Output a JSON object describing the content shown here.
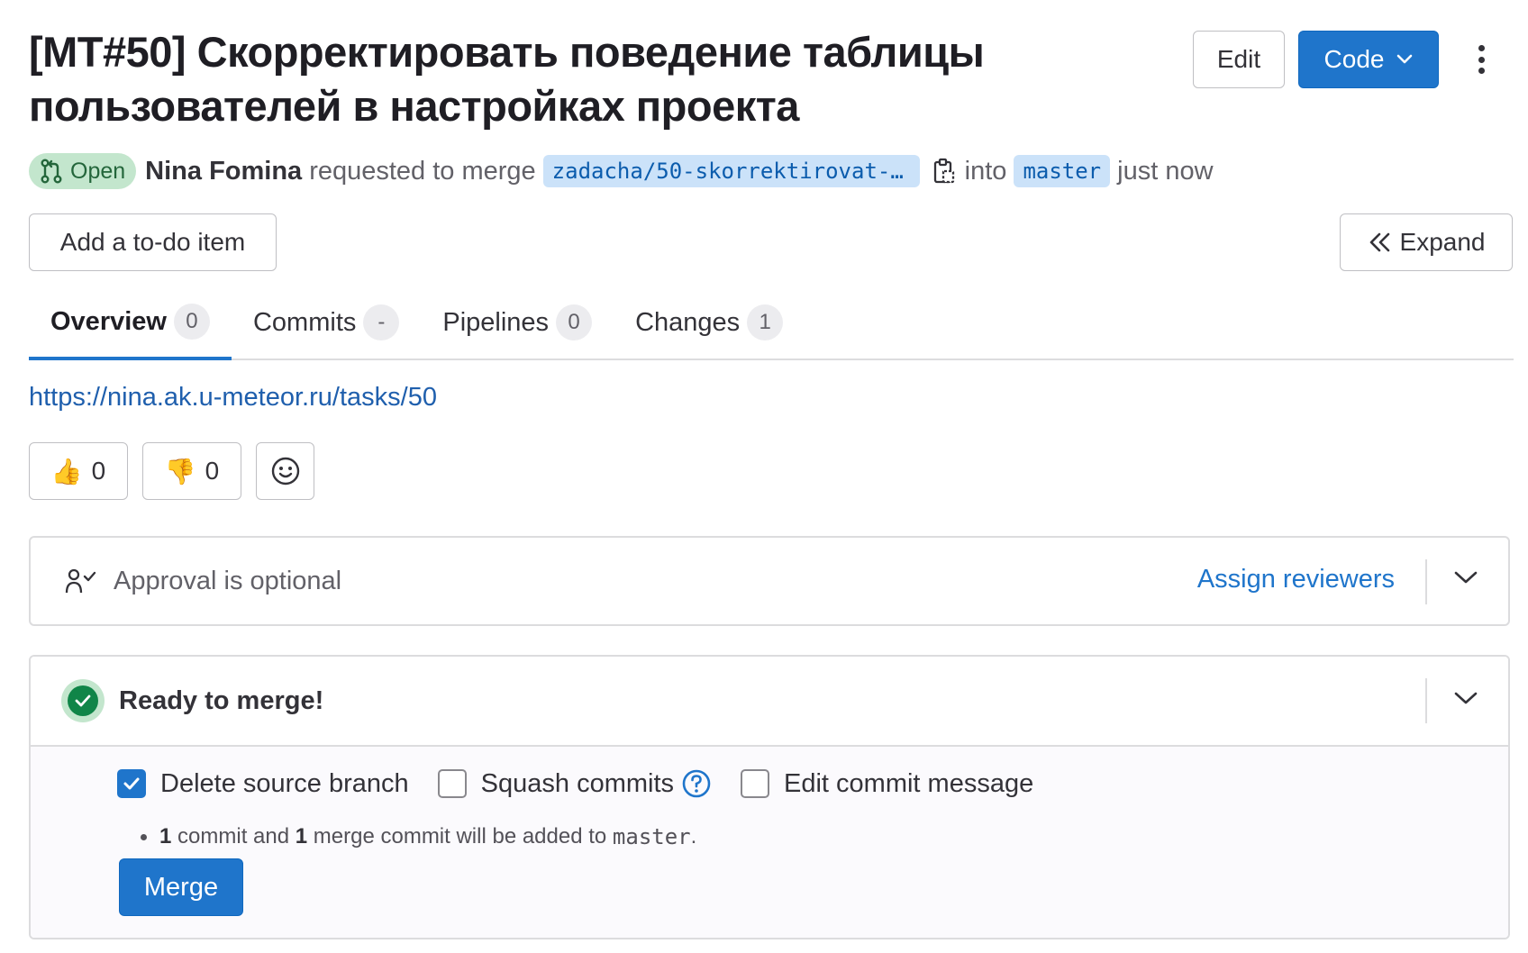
{
  "header": {
    "title": "[MT#50] Скорректировать поведение таблицы пользователей в настройках проекта",
    "edit_label": "Edit",
    "code_label": "Code"
  },
  "meta": {
    "status": "Open",
    "author": "Nina Fomina",
    "action": "requested to merge",
    "source_branch": "zadacha/50-skorrektirovat-…",
    "into": "into",
    "target_branch": "master",
    "time": "just now"
  },
  "actions": {
    "todo_label": "Add a to-do item",
    "expand_label": "Expand"
  },
  "tabs": [
    {
      "label": "Overview",
      "count": "0"
    },
    {
      "label": "Commits",
      "count": "-"
    },
    {
      "label": "Pipelines",
      "count": "0"
    },
    {
      "label": "Changes",
      "count": "1"
    }
  ],
  "description": {
    "link": "https://nina.ak.u-meteor.ru/tasks/50"
  },
  "reactions": {
    "thumbs_up": {
      "emoji": "👍",
      "count": "0"
    },
    "thumbs_down": {
      "emoji": "👎",
      "count": "0"
    }
  },
  "approval": {
    "text": "Approval is optional",
    "assign_label": "Assign reviewers"
  },
  "merge": {
    "status": "Ready to merge!",
    "options": {
      "delete_source": "Delete source branch",
      "squash": "Squash commits",
      "edit_message": "Edit commit message"
    },
    "delete_source_checked": true,
    "squash_checked": false,
    "edit_message_checked": false,
    "note": {
      "n_commits": "1",
      "text1": " commit and ",
      "n_merge": "1",
      "text2": " merge commit will be added to ",
      "target": "master",
      "end": "."
    },
    "merge_label": "Merge"
  },
  "colors": {
    "primary": "#1f75cb",
    "success": "#108548",
    "open_badge_bg": "#c3e6cd",
    "ref_bg": "#cbe2f9"
  }
}
